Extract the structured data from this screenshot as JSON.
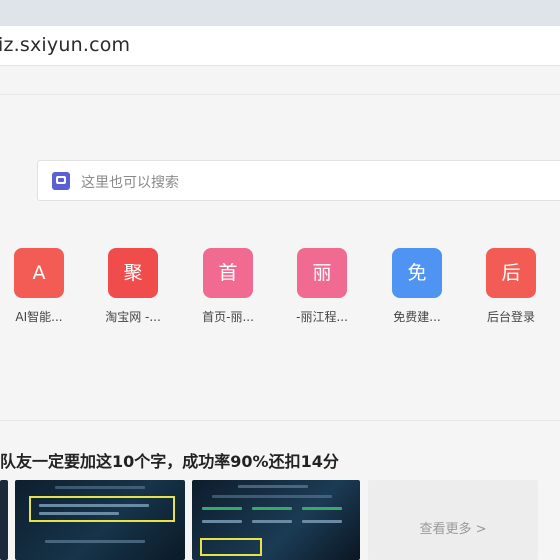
{
  "browser": {
    "address": "iz.sxiyun.com"
  },
  "search": {
    "placeholder": "这里也可以搜索"
  },
  "quick_links": [
    {
      "glyph": "A",
      "label": "AI智能...",
      "color": "#f25c54"
    },
    {
      "glyph": "聚",
      "label": "淘宝网 -...",
      "color": "#f04c4c"
    },
    {
      "glyph": "首",
      "label": "首页-丽...",
      "color": "#f06a92"
    },
    {
      "glyph": "丽",
      "label": "-丽江程...",
      "color": "#f06a92"
    },
    {
      "glyph": "免",
      "label": "免费建...",
      "color": "#4f93f3"
    },
    {
      "glyph": "后",
      "label": "后台登录",
      "color": "#f25c54"
    }
  ],
  "feed": {
    "headline": "队友一定要加这10个字，成功率90%还扣14分",
    "more_label": "查看更多 >"
  }
}
